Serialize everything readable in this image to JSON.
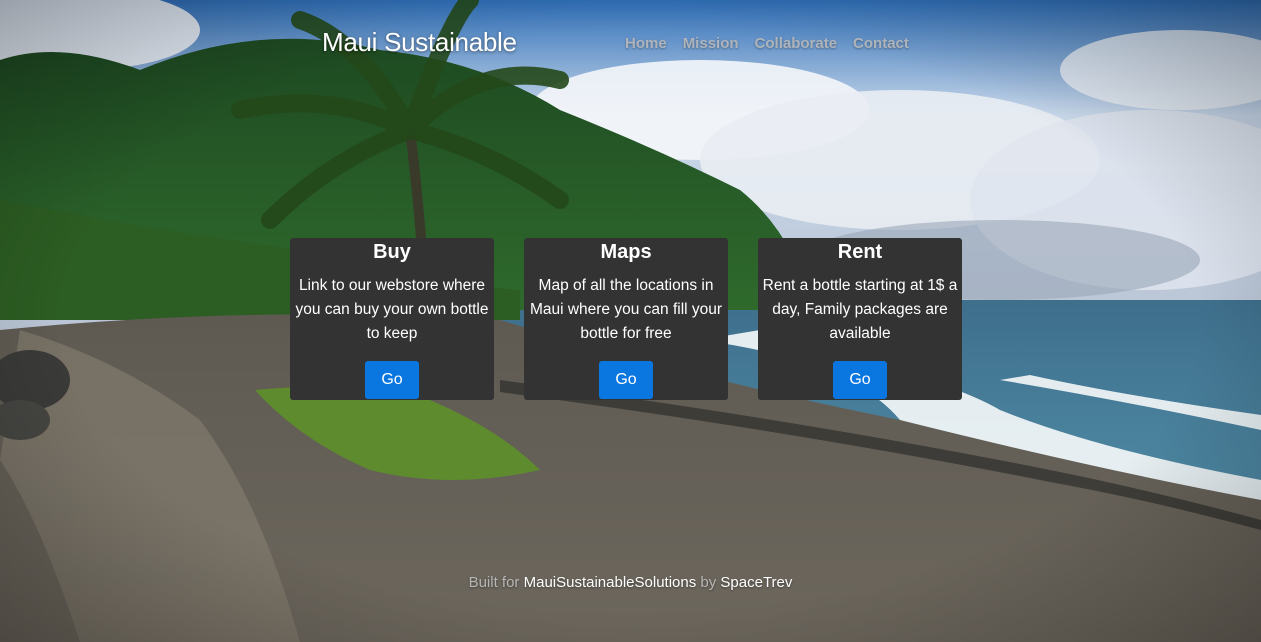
{
  "header": {
    "brand": "Maui Sustainable",
    "nav": [
      "Home",
      "Mission",
      "Collaborate",
      "Contact"
    ]
  },
  "cards": [
    {
      "title": "Buy",
      "text": "Link to our webstore where you can buy your own bottle to keep",
      "button": "Go"
    },
    {
      "title": "Maps",
      "text": "Map of all the locations in Maui where you can fill your bottle for free",
      "button": "Go"
    },
    {
      "title": "Rent",
      "text": "Rent a bottle starting at 1$ a day, Family packages are available",
      "button": "Go"
    }
  ],
  "footer": {
    "prefix": "Built for",
    "org": "MauiSustainableSolutions",
    "by": "by",
    "author": "SpaceTrev"
  },
  "colors": {
    "card_bg": "#333333",
    "button": "#0a76e0"
  }
}
